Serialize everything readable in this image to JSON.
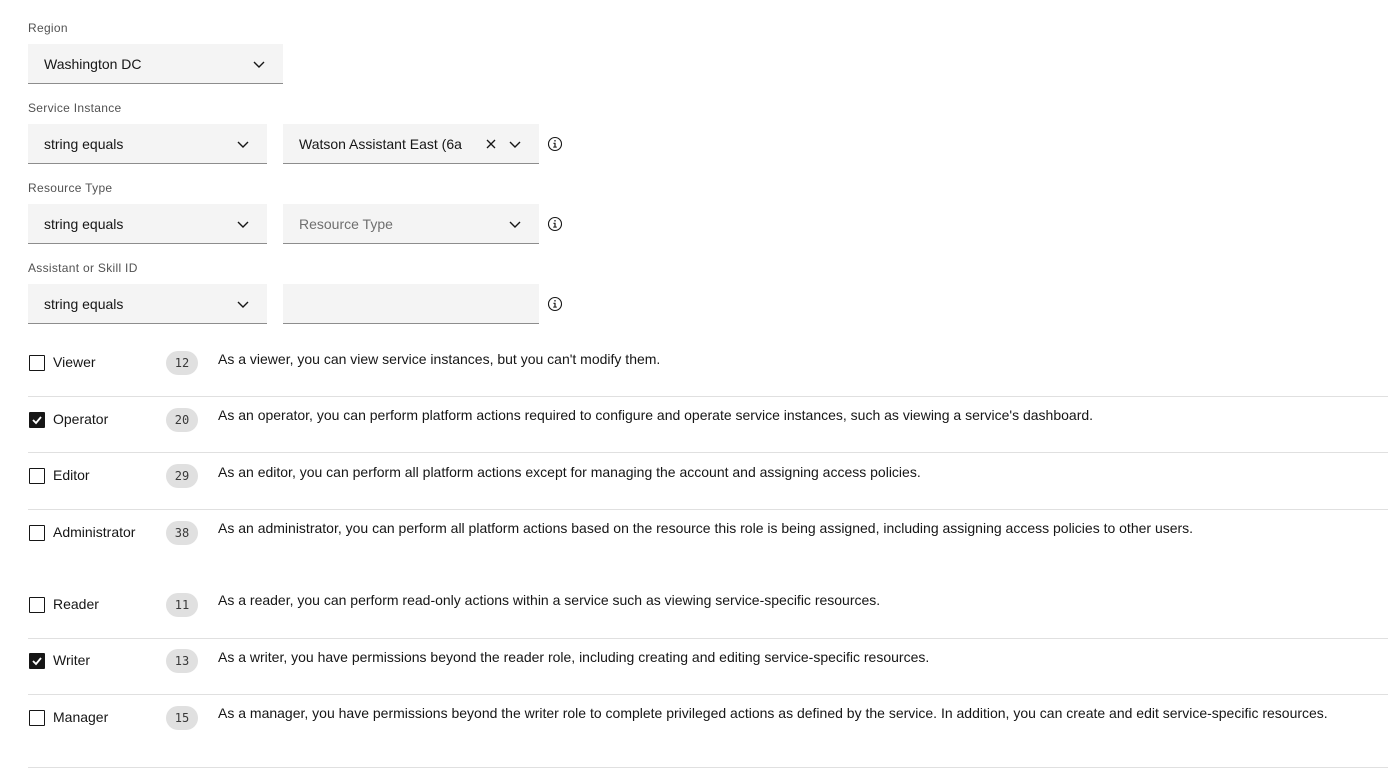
{
  "region": {
    "label": "Region",
    "value": "Washington DC"
  },
  "service_instance": {
    "label": "Service Instance",
    "operator": "string equals",
    "value": "Watson Assistant East (6a"
  },
  "resource_type": {
    "label": "Resource Type",
    "operator": "string equals",
    "placeholder": "Resource Type"
  },
  "assistant_skill_id": {
    "label": "Assistant or Skill ID",
    "operator": "string equals",
    "value": ""
  },
  "roles": [
    {
      "name": "Viewer",
      "count": "12",
      "checked": false,
      "description": "As a viewer, you can view service instances, but you can't modify them."
    },
    {
      "name": "Operator",
      "count": "20",
      "checked": true,
      "description": "As an operator, you can perform platform actions required to configure and operate service instances, such as viewing a service's dashboard."
    },
    {
      "name": "Editor",
      "count": "29",
      "checked": false,
      "description": "As an editor, you can perform all platform actions except for managing the account and assigning access policies."
    },
    {
      "name": "Administrator",
      "count": "38",
      "checked": false,
      "description": "As an administrator, you can perform all platform actions based on the resource this role is being assigned, including assigning access policies to other users."
    },
    {
      "name": "Reader",
      "count": "11",
      "checked": false,
      "description": "As a reader, you can perform read-only actions within a service such as viewing service-specific resources."
    },
    {
      "name": "Writer",
      "count": "13",
      "checked": true,
      "description": "As a writer, you have permissions beyond the reader role, including creating and editing service-specific resources."
    },
    {
      "name": "Manager",
      "count": "15",
      "checked": false,
      "description": "As a manager, you have permissions beyond the writer role to complete privileged actions as defined by the service. In addition, you can create and edit service-specific resources."
    }
  ],
  "icons": {
    "chevron": "chevron-down-icon",
    "clear": "close-icon",
    "info": "information-icon",
    "check": "checkmark-icon"
  }
}
